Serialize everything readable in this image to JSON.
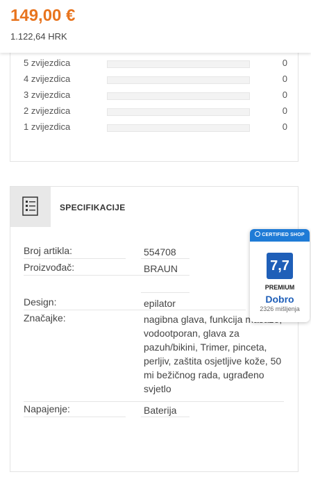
{
  "price": {
    "amount": "149,00 €",
    "secondary": "1.122,64 HRK"
  },
  "ratings": [
    {
      "label": "5 zvijezdica",
      "count": "0",
      "fraction": 0
    },
    {
      "label": "4 zvijezdica",
      "count": "0",
      "fraction": 0
    },
    {
      "label": "3 zvijezdica",
      "count": "0",
      "fraction": 0
    },
    {
      "label": "2 zvijezdica",
      "count": "0",
      "fraction": 0
    },
    {
      "label": "1 zvijezdica",
      "count": "0",
      "fraction": 0
    }
  ],
  "specs": {
    "title": "SPECIFIKACIJE",
    "icon": "list-icon",
    "rows": [
      {
        "key": "Broj artikla:",
        "value": "554708"
      },
      {
        "key": "Proizvođač:",
        "value": "BRAUN"
      },
      {
        "key": "Design:",
        "value": "epilator"
      },
      {
        "key": "Značajke:",
        "value": "nagibna glava, funkcija masaže, vodootporan, glava za pazuh/bikini, Trimer, pinceta, perljiv, zaštita osjetljive kože, 50 mi bežičnog rada, ugrađeno svjetlo"
      },
      {
        "key": "Napajenje:",
        "value": "Baterija"
      }
    ]
  },
  "badge": {
    "header": "CERTIFIED SHOP",
    "score": "7,7",
    "level": "PREMIUM",
    "grade": "Dobro",
    "reviews": "2326 mišljenja"
  },
  "colors": {
    "price": "#e8741e",
    "badge_blue": "#1f5fb8",
    "badge_header": "#1f7bd6"
  }
}
